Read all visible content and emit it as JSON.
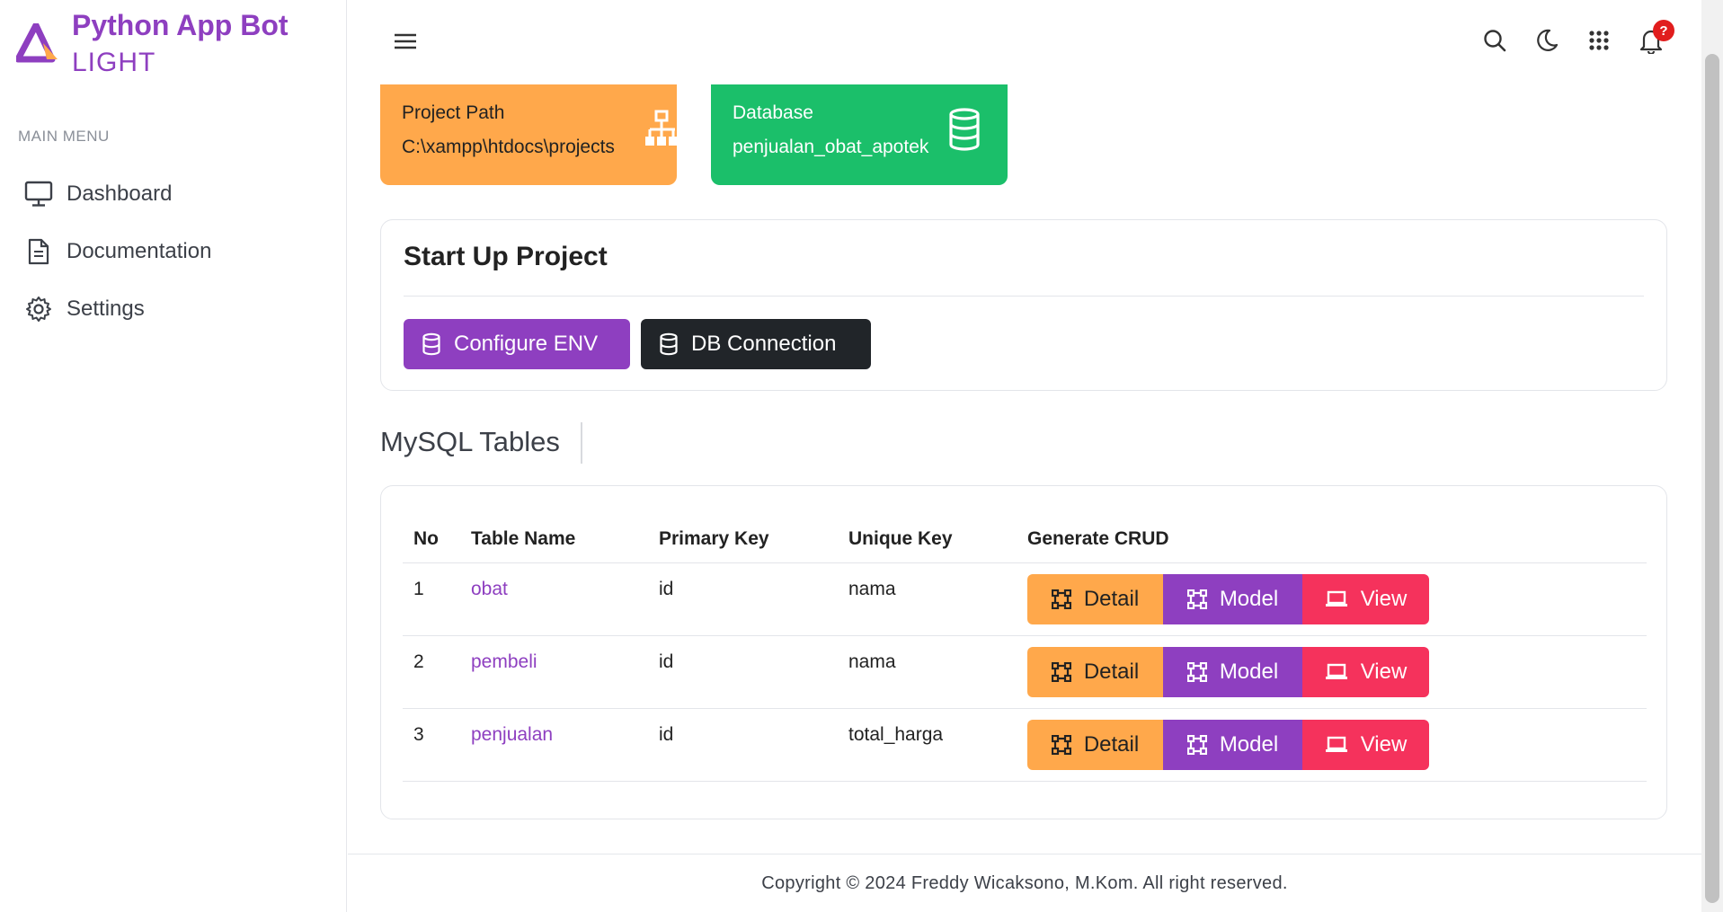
{
  "brand": {
    "title": "Python App Bot",
    "subtitle": "LIGHT"
  },
  "sidebar": {
    "heading": "MAIN MENU",
    "items": [
      {
        "label": "Dashboard",
        "icon": "monitor-icon"
      },
      {
        "label": "Documentation",
        "icon": "document-icon"
      },
      {
        "label": "Settings",
        "icon": "gear-icon"
      }
    ]
  },
  "topbar": {
    "icons": [
      "search-icon",
      "moon-icon",
      "apps-grid-icon",
      "bell-icon"
    ],
    "notification_badge": "?"
  },
  "cards": {
    "project_path": {
      "label": "Project Path",
      "value": "C:\\xampp\\htdocs\\projects",
      "icon": "sitemap-icon"
    },
    "database": {
      "label": "Database",
      "value": "penjualan_obat_apotek",
      "icon": "database-icon"
    }
  },
  "startup": {
    "title": "Start Up Project",
    "configure_env_label": "Configure ENV",
    "db_connection_label": "DB Connection"
  },
  "tables_section": {
    "title": "MySQL Tables"
  },
  "table": {
    "headers": {
      "no": "No",
      "name": "Table Name",
      "pk": "Primary Key",
      "uk": "Unique Key",
      "gen": "Generate CRUD"
    },
    "rows": [
      {
        "no": "1",
        "name": "obat",
        "pk": "id",
        "uk": "nama"
      },
      {
        "no": "2",
        "name": "pembeli",
        "pk": "id",
        "uk": "nama"
      },
      {
        "no": "3",
        "name": "penjualan",
        "pk": "id",
        "uk": "total_harga"
      }
    ],
    "actions": {
      "detail": "Detail",
      "model": "Model",
      "view": "View"
    }
  },
  "footer": {
    "text": "Copyright © 2024 Freddy Wicaksono, M.Kom. All right reserved."
  },
  "colors": {
    "accent": "#8e3fc0",
    "orange": "#ffa84b",
    "green": "#1bbf6a",
    "pink": "#f5325c",
    "dark": "#212529"
  }
}
